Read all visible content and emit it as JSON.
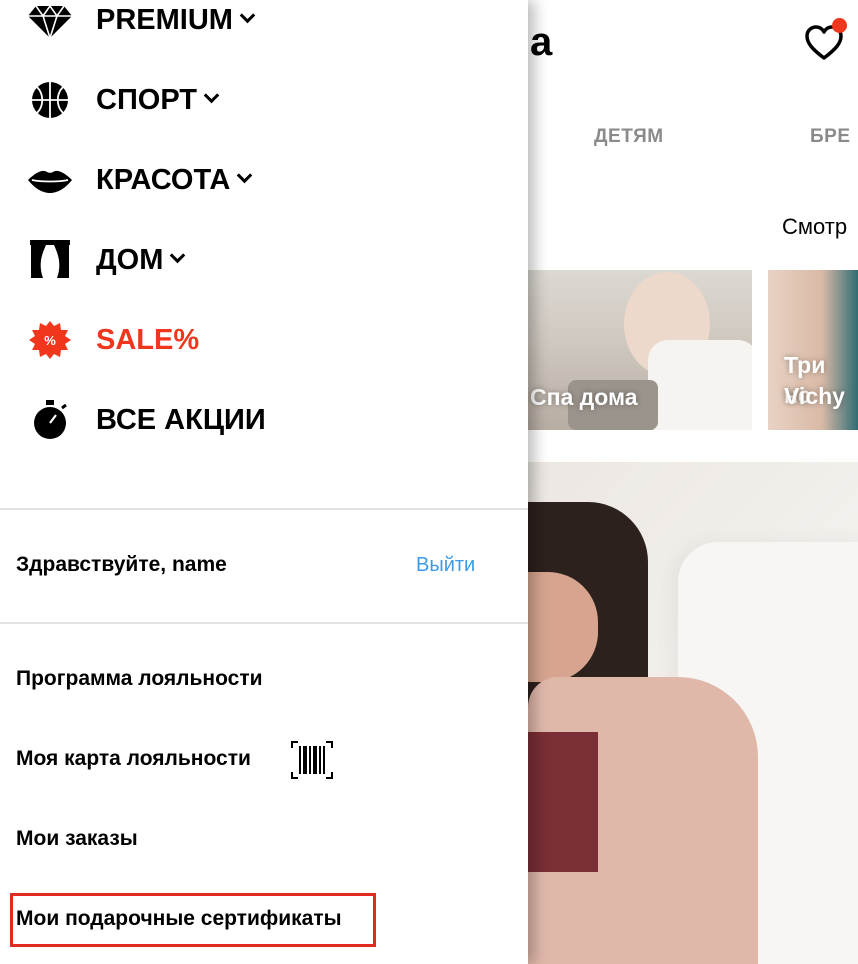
{
  "background": {
    "logo_fragment": "a",
    "category_tabs": [
      "ДЕТЯМ",
      "БРЕ"
    ],
    "see_all_label": "Смотр",
    "cards": [
      {
        "title": "Спа дома"
      },
      {
        "title_line1": "Три нс",
        "title_line2": "Vichy"
      }
    ]
  },
  "menu": {
    "items": [
      {
        "label": "PREMIUM",
        "icon": "diamond-icon"
      },
      {
        "label": "СПОРТ",
        "icon": "basketball-icon"
      },
      {
        "label": "КРАСОТА",
        "icon": "lips-icon"
      },
      {
        "label": "ДОМ",
        "icon": "curtains-icon"
      },
      {
        "label": "SALE%",
        "icon": "percent-badge-icon"
      },
      {
        "label": "ВСЕ АКЦИИ",
        "icon": "stopwatch-icon"
      }
    ]
  },
  "account": {
    "greeting": "Здравствуйте, name",
    "logout_label": "Выйти",
    "links": [
      {
        "label": "Программа лояльности"
      },
      {
        "label": "Моя карта лояльности",
        "icon": "barcode-icon"
      },
      {
        "label": "Мои заказы"
      },
      {
        "label": "Мои подарочные сертификаты"
      }
    ]
  },
  "colors": {
    "sale": "#f0371e",
    "logout_link": "#3d9be9",
    "highlight_box": "#e02a22",
    "favorites_badge": "#f0371e"
  }
}
